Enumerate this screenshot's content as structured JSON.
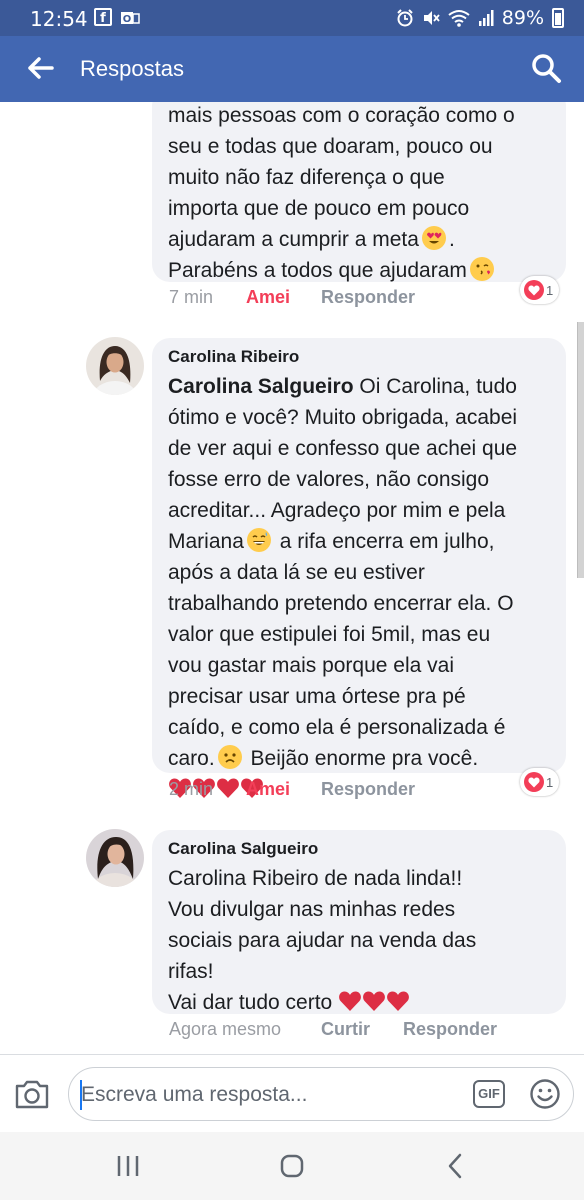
{
  "status_bar": {
    "time": "12:54",
    "battery": "89%",
    "notif_icons": [
      "facebook-icon",
      "outlook-icon"
    ],
    "system_icons": [
      "alarm-icon",
      "mute-icon",
      "wifi-icon",
      "signal-icon",
      "battery-icon"
    ]
  },
  "header": {
    "title": "Respostas"
  },
  "comments": [
    {
      "author": "",
      "lines": [
        "mais pessoas com o coração como o",
        "seu e todas que doaram, pouco ou",
        "muito não faz diferença o que",
        "importa que de pouco em pouco",
        "ajudaram a cumprir a meta",
        "Parabéns a todos que ajudaram"
      ],
      "time": "7 min",
      "like_label": "Amei",
      "reply_label": "Responder",
      "reaction_count": "1"
    },
    {
      "author": "Carolina Ribeiro",
      "mention": "Carolina Salgueiro",
      "lines": [
        " Oi Carolina, tudo",
        "ótimo e você? Muito obrigada, acabei",
        "de ver aqui e confesso que achei que",
        "fosse erro de valores, não consigo",
        "acreditar... Agradeço por mim e pela",
        "Mariana",
        " a rifa encerra em julho,",
        "após a data lá se eu estiver",
        "trabalhando pretendo encerrar ela. O",
        "valor que estipulei foi 5mil, mas eu",
        "vou gastar mais porque ela vai",
        "precisar usar uma órtese pra pé",
        "caído, e como ela é personalizada é",
        "caro.",
        " Beijão enorme pra você."
      ],
      "time": "2 min",
      "like_label": "Amei",
      "reply_label": "Responder",
      "reaction_count": "1"
    },
    {
      "author": "Carolina Salgueiro",
      "lines": [
        "Carolina Ribeiro de nada linda!!",
        "Vou divulgar nas minhas redes",
        "sociais para ajudar na venda das",
        "rifas!",
        "Vai dar tudo certo"
      ],
      "time": "Agora mesmo",
      "like_label": "Curtir",
      "reply_label": "Responder"
    }
  ],
  "compose": {
    "placeholder": "Escreva uma resposta...",
    "gif_label": "GIF"
  },
  "colors": {
    "facebook_blue": "#4267b2",
    "love_red": "#f33e58",
    "bubble_bg": "#f1f2f6"
  }
}
